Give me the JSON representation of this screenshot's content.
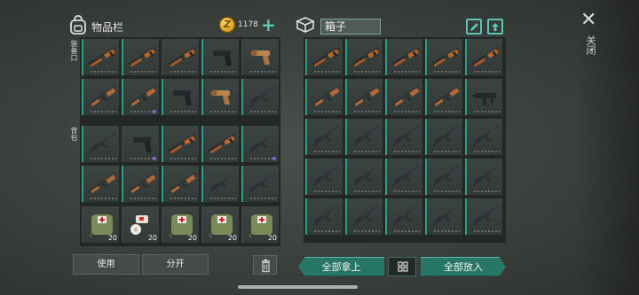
{
  "inventory": {
    "title": "物品栏",
    "coins": "1178",
    "coin_symbol": "Z",
    "add_icon": "plus-icon",
    "section_equipped": "装备口",
    "section_backpack": "背包",
    "use_button": "使用",
    "split_button": "分开",
    "trash_icon": "trash-icon"
  },
  "box": {
    "title": "箱子",
    "take_all": "全部拿上",
    "put_all": "全部放入",
    "sort_icon": "grid-sort-icon",
    "edit_icon": "edit-icon",
    "upload_icon": "upload-icon"
  },
  "close": {
    "icon": "close-icon",
    "label": "关闭"
  },
  "colors": {
    "accent": "#2a9d88",
    "rare": "#8a63d6",
    "button": "#287766"
  },
  "left_slots": [
    {
      "item": "shotgun",
      "border": true
    },
    {
      "item": "shotgun",
      "border": true
    },
    {
      "item": "shotgun",
      "border": false
    },
    {
      "item": "pistol",
      "border": true
    },
    {
      "item": "flare-pistol",
      "border": false
    },
    {
      "item": "ak-rifle",
      "border": true
    },
    {
      "item": "ak-rifle",
      "border": true,
      "rare": true
    },
    {
      "item": "pistol",
      "border": true
    },
    {
      "item": "flare-pistol",
      "border": true
    },
    {
      "item": "rifle",
      "border": true
    },
    {
      "item": "rifle",
      "border": true
    },
    {
      "item": "pistol",
      "border": false,
      "rare": true
    },
    {
      "item": "shotgun",
      "border": true
    },
    {
      "item": "shotgun",
      "border": true
    },
    {
      "item": "rifle",
      "border": true,
      "rare": true
    },
    {
      "item": "ak-rifle",
      "border": true
    },
    {
      "item": "ak-rifle",
      "border": true
    },
    {
      "item": "ak-rifle",
      "border": true
    },
    {
      "item": "rifle",
      "border": true
    },
    {
      "item": "rifle",
      "border": true
    },
    {
      "item": "medkit-bag",
      "qty": "20"
    },
    {
      "item": "bandage",
      "qty": "20"
    },
    {
      "item": "medkit-bag",
      "qty": "20"
    },
    {
      "item": "medkit-bag",
      "qty": "20"
    },
    {
      "item": "medkit-bag",
      "qty": "20"
    }
  ],
  "right_slots": [
    "shotgun",
    "shotgun",
    "shotgun",
    "shotgun",
    "shotgun",
    "ak-rifle",
    "ak-rifle",
    "ak-rifle",
    "ak-rifle",
    "smg",
    "rifle",
    "rifle",
    "rifle",
    "rifle",
    "rifle",
    "rifle",
    "rifle",
    "rifle",
    "rifle",
    "rifle",
    "rifle",
    "rifle",
    "rifle",
    "rifle",
    "rifle"
  ]
}
